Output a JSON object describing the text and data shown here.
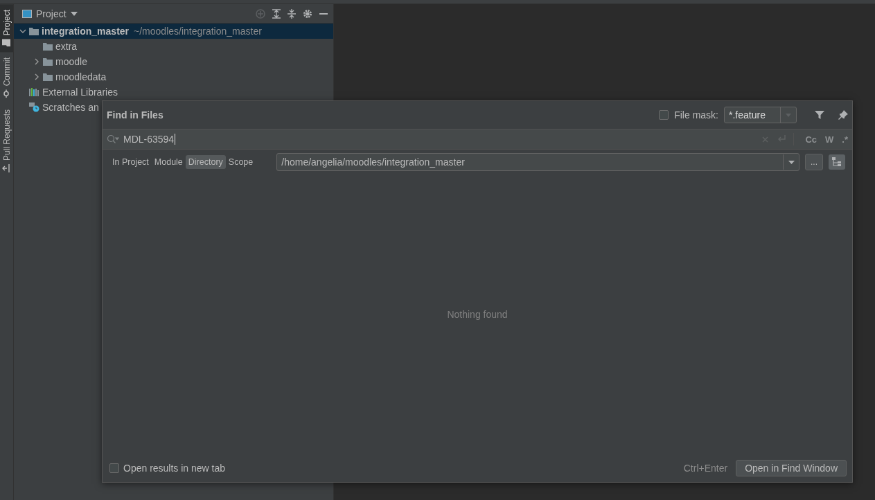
{
  "tool_stripe": [
    {
      "label": "Project",
      "selected": true
    },
    {
      "label": "Commit",
      "selected": false
    },
    {
      "label": "Pull Requests",
      "selected": false
    }
  ],
  "project_panel": {
    "title": "Project",
    "tree": [
      {
        "name": "integration_master",
        "path": "~/moodles/integration_master",
        "kind": "folder",
        "expanded": true,
        "selected": true,
        "children": [
          {
            "name": "extra",
            "kind": "folder",
            "selected": false
          },
          {
            "name": "moodle",
            "kind": "folder",
            "expanded": false,
            "selected": false
          },
          {
            "name": "moodledata",
            "kind": "folder",
            "expanded": false,
            "selected": false
          }
        ]
      },
      {
        "name": "External Libraries",
        "kind": "library",
        "selected": false
      },
      {
        "name": "Scratches an",
        "kind": "scratch",
        "selected": false
      }
    ]
  },
  "dialog": {
    "title": "Find in Files",
    "file_mask": {
      "label": "File mask:",
      "checked": false,
      "value": "*.feature"
    },
    "search": {
      "value": "MDL-63594",
      "toggles": [
        "Cc",
        "W",
        ".*"
      ]
    },
    "scopes": [
      {
        "label": "In Project",
        "selected": false
      },
      {
        "label": "Module",
        "selected": false
      },
      {
        "label": "Directory",
        "selected": true
      },
      {
        "label": "Scope",
        "selected": false
      }
    ],
    "directory": {
      "value": "/home/angelia/moodles/integration_master",
      "browse": "..."
    },
    "message": "Nothing found",
    "open_in_new_tab": {
      "label": "Open results in new tab",
      "checked": false
    },
    "shortcut": "Ctrl+Enter",
    "button": "Open in Find Window"
  }
}
